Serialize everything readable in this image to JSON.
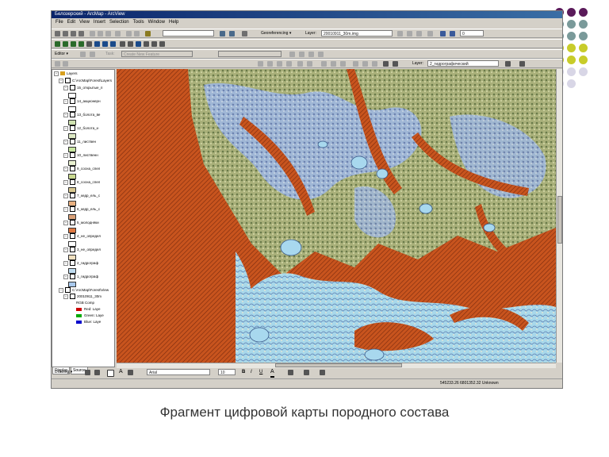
{
  "window": {
    "title": "Белозерский - ArcMap - ArcView",
    "menus": [
      "File",
      "Edit",
      "View",
      "Insert",
      "Selection",
      "Tools",
      "Window",
      "Help"
    ]
  },
  "toolbar1": {
    "scale_value": "",
    "georeferencing_label": "Georeferencing ▾",
    "layer_label": "Layer:",
    "layer_value": "20010911_30m.img",
    "zoom_value": "0"
  },
  "toolbar2": {
    "editor_label": "Editor ▾",
    "task_value": "Create New Feature",
    "layer_label": "Layer:",
    "layer_value": "2_гидрографический"
  },
  "toc": {
    "root": "Layers",
    "group1": "C:\\ArcMap\\Forest\\Layers",
    "layers": [
      "15_открытые_п",
      "14_акционерн",
      "13_болота_ве",
      "12_болота_к-",
      "11_листвен",
      "10_лиственн",
      "9_сосна_спел",
      "8_сосна_спел",
      "7_кедр_ель_с",
      "6_кедр_ель_с",
      "5_молодняки",
      "4_не_определ",
      "3_не_определ",
      "2_гидрограф",
      "1_гидрограф"
    ],
    "group2": "C:\\ArcMap\\Forest\\View",
    "raster": "20010911_30m",
    "rgb_label": "RGB Comp",
    "bands": [
      "Red: Laye",
      "Green: Laye",
      "Blue: Laye"
    ],
    "tabs": [
      "Display",
      "Source"
    ],
    "swatch_colors": [
      "#ffffff",
      "#ffffff",
      "#cfe2b0",
      "#dde9c4",
      "#c8e6a0",
      "#e8f0d0",
      "#c9d98f",
      "#d8c890",
      "#e8b080",
      "#d9a078",
      "#e07840",
      "#ffffff",
      "#f0e0c0",
      "#c0dcf0",
      "#a8c8ec"
    ],
    "band_colors": [
      "#cc0000",
      "#00aa00",
      "#0000cc"
    ]
  },
  "drawing": {
    "drawing_label": "Drawing ▾",
    "font_value": "Arial",
    "size_value": "10",
    "bold": "B",
    "italic": "I",
    "underline": "U"
  },
  "status": {
    "coords": "545233.26  6801352.32 Unknown"
  },
  "caption": "Фрагмент цифровой карты породного состава",
  "decor_colors": [
    "#5a1a5a",
    "#7a9a9a",
    "#c8cc2a",
    "#d8d6e6"
  ]
}
